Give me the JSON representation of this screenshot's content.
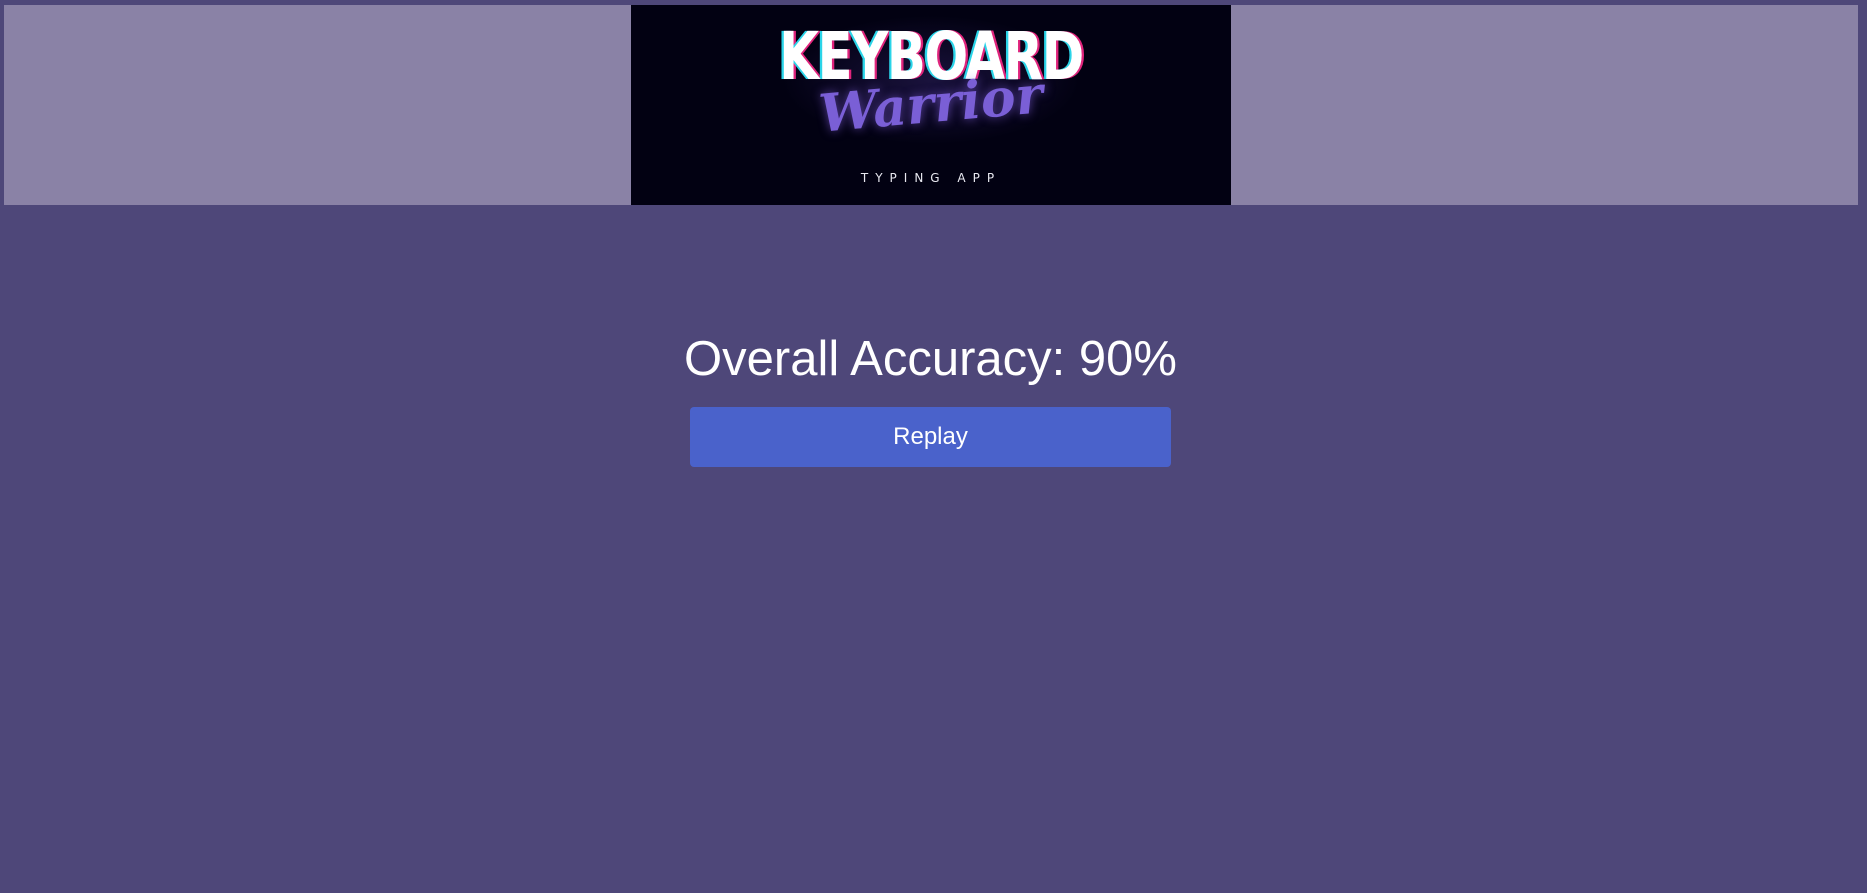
{
  "header": {
    "logo": {
      "title": "KEYBOARD",
      "script": "Warrior",
      "subtitle": "TYPING APP"
    }
  },
  "main": {
    "accuracy_text": "Overall Accuracy: 90%",
    "accuracy_percent": 90,
    "replay_label": "Replay"
  },
  "colors": {
    "page_background": "#4e4779",
    "header_band": "#8a82a6",
    "logo_background": "#020112",
    "button_background": "#4a62cb",
    "text": "#ffffff"
  }
}
